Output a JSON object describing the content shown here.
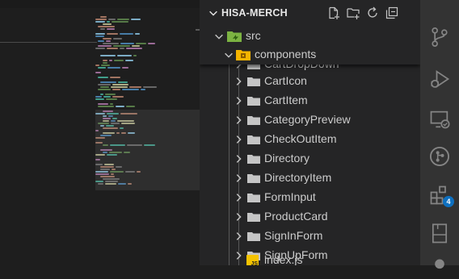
{
  "explorer": {
    "section_title": "HISA-MERCH",
    "root": {
      "label": "src"
    },
    "current": {
      "label": "components"
    },
    "partial_item": {
      "label": "CartDropDown"
    },
    "folders": [
      {
        "label": "CartIcon"
      },
      {
        "label": "CartItem"
      },
      {
        "label": "CategoryPreview"
      },
      {
        "label": "CheckOutItem"
      },
      {
        "label": "Directory"
      },
      {
        "label": "DirectoryItem"
      },
      {
        "label": "FormInput"
      },
      {
        "label": "ProductCard"
      },
      {
        "label": "SignInForm"
      },
      {
        "label": "SignUpForm"
      }
    ],
    "file": {
      "label": "index.js",
      "badge": "JS"
    },
    "actions": [
      "new-file-icon",
      "new-folder-icon",
      "refresh-icon",
      "collapse-all-icon"
    ]
  },
  "activity_bar": {
    "items": [
      "source-control-icon",
      "run-debug-icon",
      "remote-explorer-icon",
      "github-icon",
      "extensions-icon",
      "bookmark-icon"
    ],
    "extensions_badge": "4"
  },
  "colors": {
    "sidebar_bg": "#252526",
    "activity_bg": "#333333",
    "editor_bg": "#1e1e1e",
    "text": "#cccccc",
    "folder": "#c5c5c5",
    "src_folder": "#7cb342",
    "components_folder": "#f5b400",
    "js_badge": "#f5c300",
    "badge_bg": "#0e70c0"
  }
}
